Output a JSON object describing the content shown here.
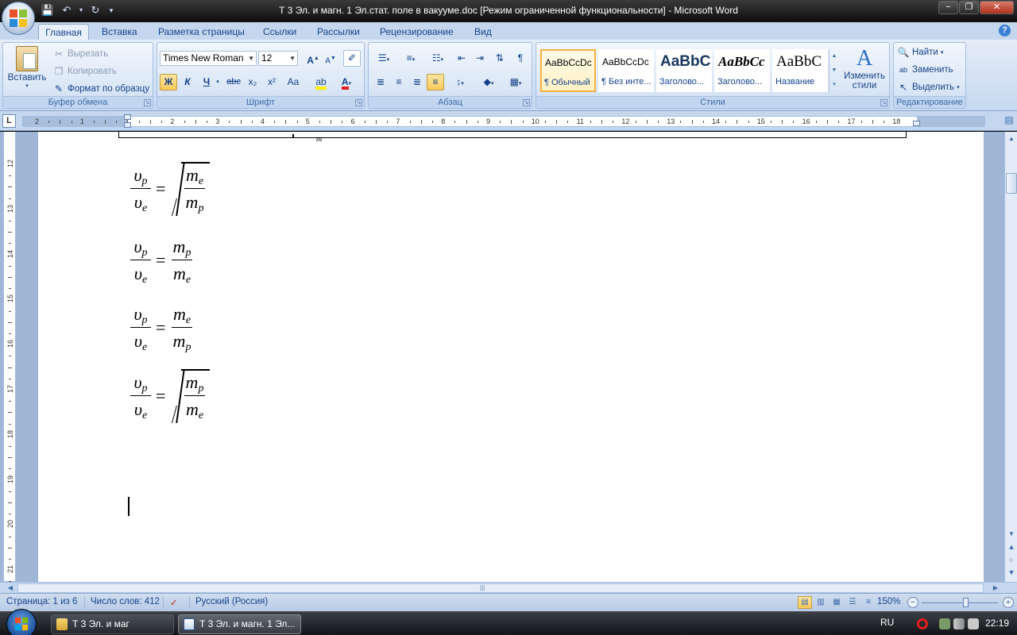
{
  "window": {
    "title": "Т 3 Эл. и магн. 1 Эл.стат. поле в вакууме.doc [Режим ограниченной функциональности]  -  Microsoft Word"
  },
  "quick_access": [
    "save-icon",
    "undo-icon",
    "redo-icon",
    "customize-icon"
  ],
  "ribbon_tabs": [
    "Главная",
    "Вставка",
    "Разметка страницы",
    "Ссылки",
    "Рассылки",
    "Рецензирование",
    "Вид"
  ],
  "clipboard": {
    "paste": "Вставить",
    "cut": "Вырезать",
    "copy": "Копировать",
    "format_painter": "Формат по образцу",
    "label": "Буфер обмена"
  },
  "font": {
    "name": "Times New Roman",
    "size": "12",
    "bold": "Ж",
    "italic": "К",
    "underline": "Ч",
    "strike": "abc",
    "subscript": "x₂",
    "superscript": "x²",
    "change_case": "Aa",
    "grow": "A",
    "shrink": "A",
    "label": "Шрифт"
  },
  "paragraph": {
    "label": "Абзац"
  },
  "styles": {
    "items": [
      {
        "preview": "AaBbCcDc",
        "name": "¶ Обычный"
      },
      {
        "preview": "AaBbCcDc",
        "name": "¶ Без инте..."
      },
      {
        "preview": "AaBbC",
        "name": "Заголово..."
      },
      {
        "preview": "AaBbCc",
        "name": "Заголово..."
      },
      {
        "preview": "AaBbC",
        "name": "Название"
      }
    ],
    "change_line1": "Изменить",
    "change_line2": "стили",
    "label": "Стили"
  },
  "editing": {
    "find": "Найти",
    "replace": "Заменить",
    "select": "Выделить",
    "label": "Редактирование"
  },
  "ruler": {
    "numbers": [
      "2",
      "1",
      "1",
      "2",
      "3",
      "4",
      "5",
      "6",
      "7",
      "8",
      "9",
      "10",
      "11",
      "12",
      "13",
      "14",
      "15",
      "16",
      "17",
      "18"
    ],
    "vertical_numbers": [
      "12",
      "13",
      "14",
      "15",
      "16",
      "17",
      "18",
      "19",
      "20",
      "21"
    ]
  },
  "document": {
    "formulas": [
      {
        "lhs_num": "υ",
        "lhs_num_sub": "p",
        "lhs_den": "υ",
        "lhs_den_sub": "e",
        "rhs_num": "m",
        "rhs_num_sub": "e",
        "rhs_den": "m",
        "rhs_den_sub": "p",
        "sqrt": true
      },
      {
        "lhs_num": "υ",
        "lhs_num_sub": "p",
        "lhs_den": "υ",
        "lhs_den_sub": "e",
        "rhs_num": "m",
        "rhs_num_sub": "p",
        "rhs_den": "m",
        "rhs_den_sub": "e",
        "sqrt": false
      },
      {
        "lhs_num": "υ",
        "lhs_num_sub": "p",
        "lhs_den": "υ",
        "lhs_den_sub": "e",
        "rhs_num": "m",
        "rhs_num_sub": "e",
        "rhs_den": "m",
        "rhs_den_sub": "p",
        "sqrt": false
      },
      {
        "lhs_num": "υ",
        "lhs_num_sub": "p",
        "lhs_den": "υ",
        "lhs_den_sub": "e",
        "rhs_num": "m",
        "rhs_num_sub": "p",
        "rhs_den": "m",
        "rhs_den_sub": "e",
        "sqrt": true
      }
    ],
    "equals": "=",
    "top_fragment": "m"
  },
  "statusbar": {
    "page": "Страница: 1 из 6",
    "words": "Число слов: 412",
    "language": "Русский (Россия)",
    "zoom": "150%",
    "zoom_fraction": 0.58
  },
  "taskbar": {
    "buttons": [
      "Т 3 Эл. и маг",
      "Т 3 Эл. и магн. 1 Эл..."
    ],
    "language": "RU",
    "time": "22:19"
  }
}
